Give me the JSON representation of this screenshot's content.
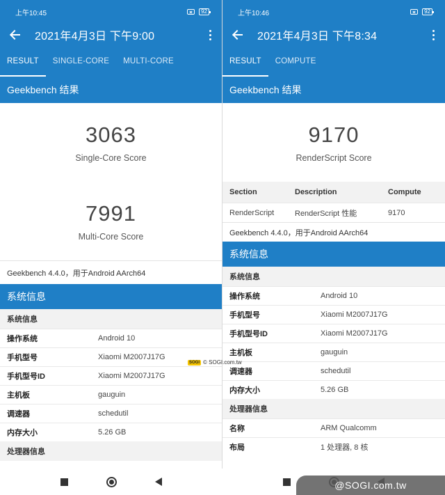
{
  "left": {
    "status_time": "上午10:45",
    "battery": "92",
    "title": "2021年4月3日 下午9:00",
    "tabs": [
      "RESULT",
      "SINGLE-CORE",
      "MULTI-CORE"
    ],
    "section_title": "Geekbench 结果",
    "single_score": "3063",
    "single_label": "Single-Core Score",
    "multi_score": "7991",
    "multi_label": "Multi-Core Score",
    "note": "Geekbench 4.4.0，用于Android AArch64",
    "sysinfo_title": "系统信息",
    "sysinfo_sub": "系统信息",
    "rows": [
      {
        "k": "操作系统",
        "v": "Android 10"
      },
      {
        "k": "手机型号",
        "v": "Xiaomi M2007J17G"
      },
      {
        "k": "手机型号ID",
        "v": "Xiaomi M2007J17G"
      },
      {
        "k": "主机板",
        "v": "gauguin"
      },
      {
        "k": "调速器",
        "v": "schedutil"
      },
      {
        "k": "内存大小",
        "v": "5.26 GB"
      }
    ],
    "proc_sub": "处理器信息"
  },
  "right": {
    "status_time": "上午10:46",
    "battery": "92",
    "title": "2021年4月3日 下午8:34",
    "tabs": [
      "RESULT",
      "COMPUTE"
    ],
    "section_title": "Geekbench 结果",
    "score": "9170",
    "score_label": "RenderScript Score",
    "table_head": [
      "Section",
      "Description",
      "Compute"
    ],
    "table_row": [
      "RenderScript",
      "RenderScript 性能",
      "9170"
    ],
    "note": "Geekbench 4.4.0，用于Android AArch64",
    "sysinfo_title": "系统信息",
    "sysinfo_sub": "系统信息",
    "rows": [
      {
        "k": "操作系统",
        "v": "Android 10"
      },
      {
        "k": "手机型号",
        "v": "Xiaomi M2007J17G"
      },
      {
        "k": "手机型号ID",
        "v": "Xiaomi M2007J17G"
      },
      {
        "k": "主机板",
        "v": "gauguin"
      },
      {
        "k": "调速器",
        "v": "schedutil"
      },
      {
        "k": "内存大小",
        "v": "5.26 GB"
      }
    ],
    "proc_sub": "处理器信息",
    "proc_rows": [
      {
        "k": "名称",
        "v": "ARM Qualcomm"
      },
      {
        "k": "布局",
        "v": "1 处理器, 8 核"
      }
    ]
  },
  "watermark": {
    "small_badge": "SOGI",
    "small_text": "© SOGI.com.tw",
    "big_text": "@SOGI.com.tw"
  },
  "colors": {
    "primary": "#1f7fc6"
  }
}
